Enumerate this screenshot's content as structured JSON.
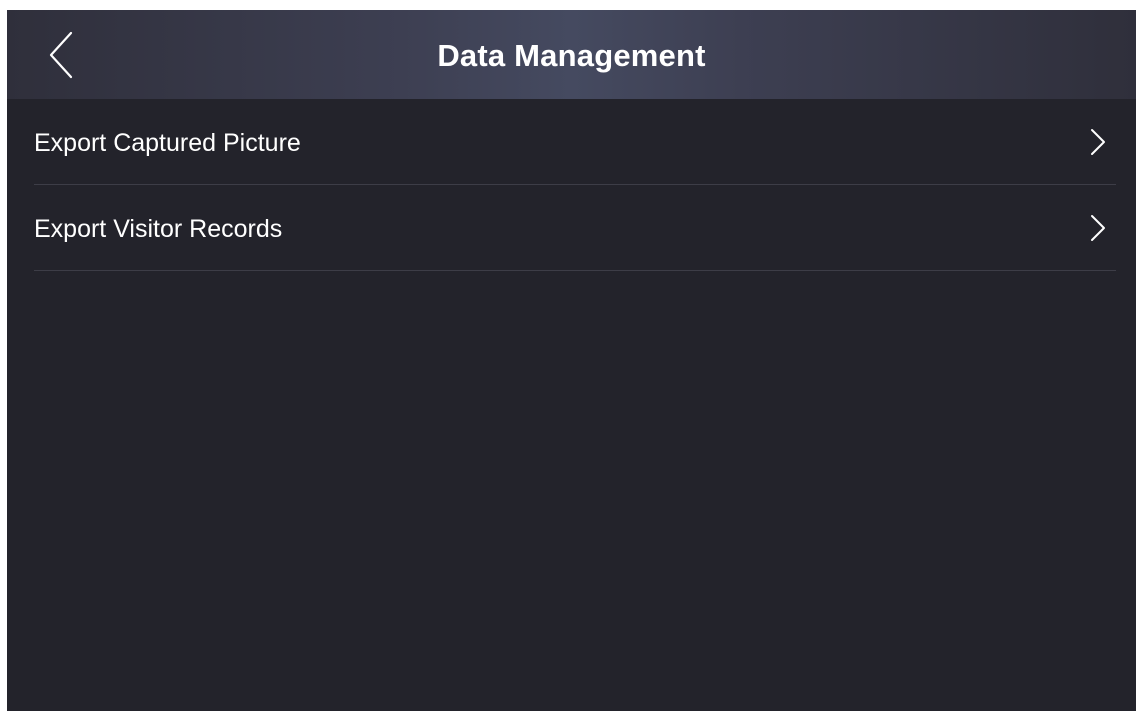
{
  "header": {
    "title": "Data Management",
    "back_icon": "chevron-left-icon"
  },
  "menu": {
    "items": [
      {
        "label": "Export Captured Picture",
        "icon": "chevron-right-icon"
      },
      {
        "label": "Export Visitor Records",
        "icon": "chevron-right-icon"
      }
    ]
  },
  "colors": {
    "background": "#23232b",
    "header_gradient_center": "#454a60",
    "text": "#ffffff",
    "divider": "#3d3d47"
  }
}
